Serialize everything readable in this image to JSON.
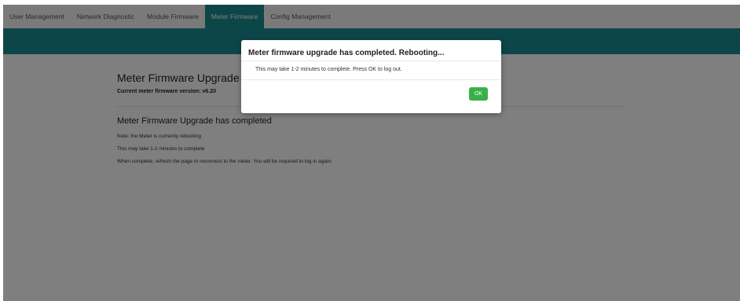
{
  "nav": {
    "tabs": [
      {
        "label": "User Management",
        "active": false
      },
      {
        "label": "Network Diagnostic",
        "active": false
      },
      {
        "label": "Module Firmware",
        "active": false
      },
      {
        "label": "Meter Firmware",
        "active": true
      },
      {
        "label": "Config Management",
        "active": false
      }
    ]
  },
  "page": {
    "title": "Meter Firmware Upgrade",
    "current_version": "Current meter firmware version: v6.20",
    "completed_heading": "Meter Firmware Upgrade has completed",
    "notes": [
      "Note: the Meter is currently rebooting",
      "This may take 1-2 minutes to complete",
      "When complete, refresh the page to reconnect to the meter. You will be required to log in again."
    ]
  },
  "modal": {
    "title": "Meter firmware upgrade has completed. Rebooting...",
    "body": "This may take 1-2 minutes to complete. Press OK to log out.",
    "ok_label": "OK"
  },
  "colors": {
    "accent": "#1a8c93",
    "ok_button": "#3bb04a",
    "overlay": "rgba(0,0,0,0.5)"
  }
}
